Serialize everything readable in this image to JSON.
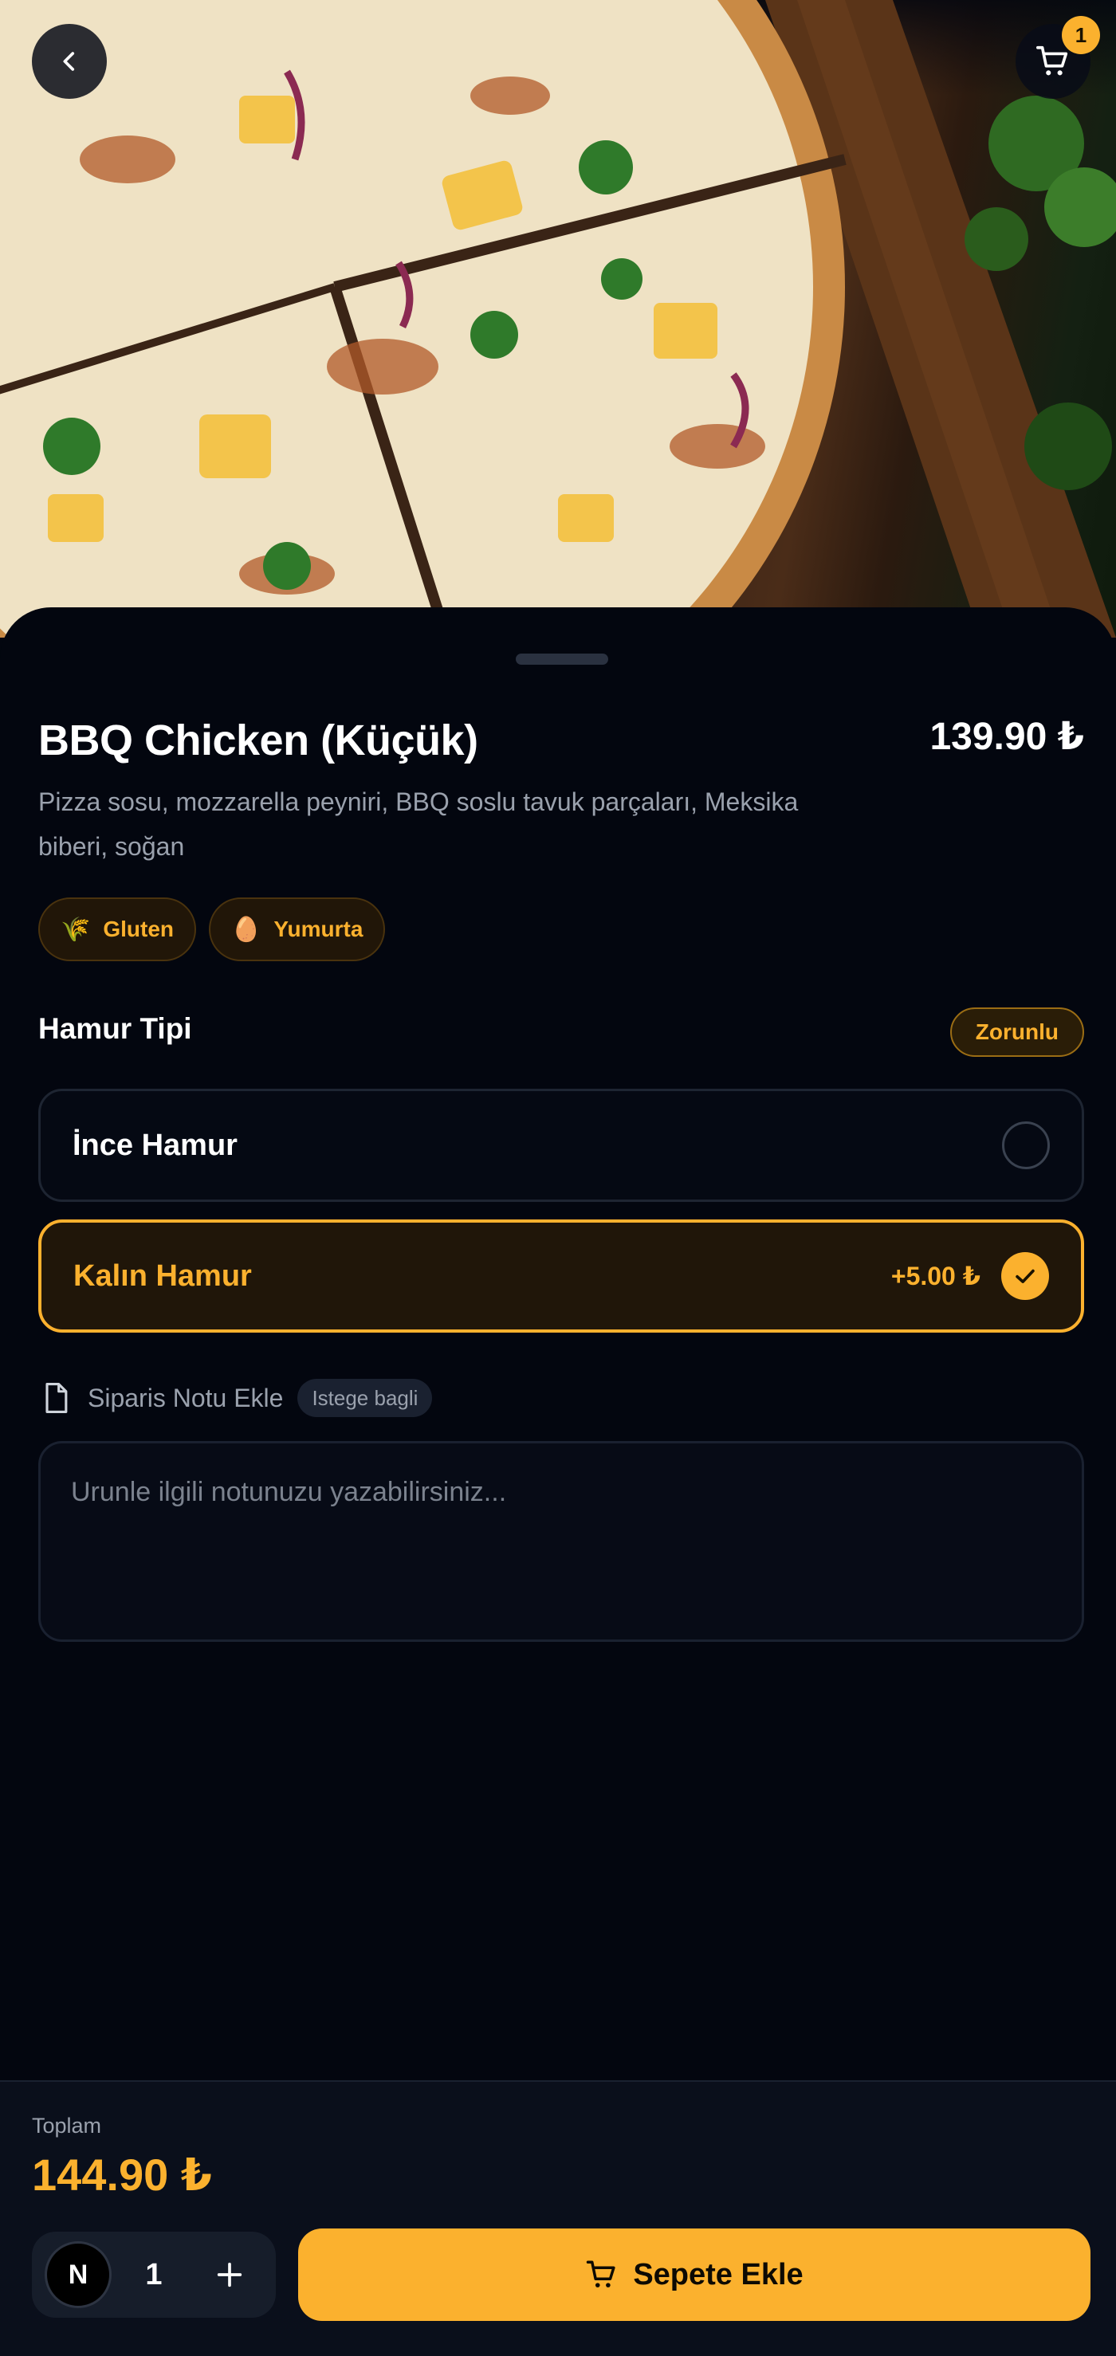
{
  "header": {
    "cart_count": "1"
  },
  "product": {
    "name": "BBQ Chicken (Küçük)",
    "price": "139.90 ₺",
    "description": "Pizza sosu, mozzarella peyniri, BBQ soslu tavuk parçaları, Meksika biberi, soğan",
    "allergens": [
      {
        "glyph": "🌾",
        "label": "Gluten"
      },
      {
        "glyph": "🥚",
        "label": "Yumurta"
      }
    ]
  },
  "dough_section": {
    "title": "Hamur Tipi",
    "required_label": "Zorunlu",
    "options": [
      {
        "label": "İnce Hamur",
        "extra": "",
        "selected": false
      },
      {
        "label": "Kalın Hamur",
        "extra": "+5.00 ₺",
        "selected": true
      }
    ]
  },
  "note": {
    "label": "Siparis Notu Ekle",
    "optional_label": "Istege bagli",
    "placeholder": "Urunle ilgili notunuzu yazabilirsiniz...",
    "value": ""
  },
  "footer": {
    "total_label": "Toplam",
    "total_value": "144.90 ₺",
    "quantity": "1",
    "minus_glyph": "N",
    "add_label": "Sepete Ekle"
  },
  "colors": {
    "accent": "#fbb12e",
    "background": "#03060f",
    "muted_text": "#9aa1ad"
  },
  "icons": [
    "chevron-left-icon",
    "cart-icon",
    "wheat-icon",
    "egg-icon",
    "check-icon",
    "document-icon",
    "plus-icon"
  ]
}
